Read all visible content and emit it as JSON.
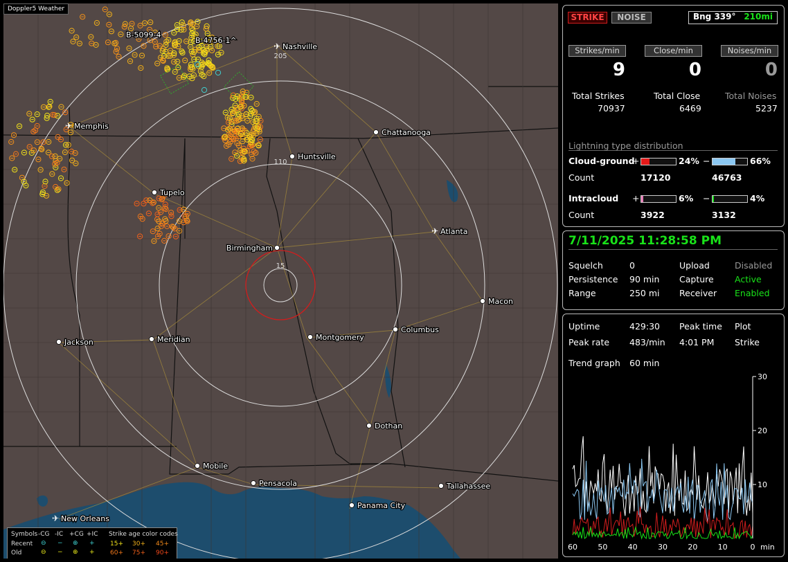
{
  "app_title": "Doppler5 Weather",
  "map": {
    "cities": [
      {
        "name": "Nashville",
        "airport": true
      },
      {
        "name": "Memphis",
        "airport": true
      },
      {
        "name": "Chattanooga",
        "airport": false
      },
      {
        "name": "Huntsville",
        "airport": false
      },
      {
        "name": "Tupelo",
        "airport": false
      },
      {
        "name": "Atlanta",
        "airport": true
      },
      {
        "name": "Birmingham",
        "airport": false
      },
      {
        "name": "Macon",
        "airport": false
      },
      {
        "name": "Jackson",
        "airport": false
      },
      {
        "name": "Meridian",
        "airport": false
      },
      {
        "name": "Montgomery",
        "airport": false
      },
      {
        "name": "Columbus",
        "airport": false
      },
      {
        "name": "Dothan",
        "airport": false
      },
      {
        "name": "Mobile",
        "airport": false
      },
      {
        "name": "Pensacola",
        "airport": false
      },
      {
        "name": "Tallahassee",
        "airport": false
      },
      {
        "name": "Panama City",
        "airport": false
      },
      {
        "name": "New Orleans",
        "airport": true
      }
    ],
    "range_labels": [
      "205",
      "110",
      "15"
    ],
    "cell_labels": [
      "B-5099-4",
      "B-4756-1^"
    ]
  },
  "legend": {
    "symbols_label": "Symbols",
    "col_headers": [
      "-CG",
      "-IC",
      "+CG",
      "+IC"
    ],
    "age_title": "Strike age color codes",
    "rows": [
      {
        "label": "Recent",
        "ages": [
          "15+",
          "30+",
          "45+"
        ]
      },
      {
        "label": "Old",
        "ages": [
          "60+",
          "75+",
          "90+"
        ]
      }
    ]
  },
  "strike_panel": {
    "mode_strike": "STRIKE",
    "mode_noise": "NOISE",
    "bearing": "Bng 339°",
    "distance": "210mi",
    "rate_labels": [
      "Strikes/min",
      "Close/min",
      "Noises/min"
    ],
    "rate_values": [
      "9",
      "0",
      "0"
    ],
    "total_labels": [
      "Total Strikes",
      "Total Close",
      "Total Noises"
    ],
    "total_values": [
      "70937",
      "6469",
      "5237"
    ],
    "distribution_title": "Lightning type distribution",
    "cloud_ground": {
      "label": "Cloud-ground",
      "plus_pct": "24%",
      "minus_pct": "66%",
      "plus_count": "17120",
      "minus_count": "46763",
      "plus_frac": 0.24,
      "minus_frac": 0.66
    },
    "intracloud": {
      "label": "Intracloud",
      "plus_pct": "6%",
      "minus_pct": "4%",
      "plus_count": "3922",
      "minus_count": "3132",
      "plus_frac": 0.06,
      "minus_frac": 0.04
    },
    "count_label": "Count",
    "plus_sign": "+",
    "minus_sign": "−"
  },
  "status_panel": {
    "datetime": "7/11/2025 11:28:58 PM",
    "rows": [
      {
        "k1": "Squelch",
        "v1": "0",
        "k2": "Upload",
        "v2": "Disabled"
      },
      {
        "k1": "Persistence",
        "v1": "90 min",
        "k2": "Capture",
        "v2": "Active"
      },
      {
        "k1": "Range",
        "v1": "250 mi",
        "k2": "Receiver",
        "v2": "Enabled"
      }
    ]
  },
  "trend_panel": {
    "uptime_label": "Uptime",
    "uptime": "429:30",
    "peak_time_label": "Peak time",
    "peak_time": "4:01 PM",
    "plot_label": "Plot",
    "plot_value": "Strike",
    "peak_rate_label": "Peak rate",
    "peak_rate": "483/min",
    "trend_label": "Trend graph",
    "trend_value": "60 min",
    "x_ticks": [
      "60",
      "50",
      "40",
      "30",
      "20",
      "10",
      "0"
    ],
    "x_unit": "min",
    "y_ticks": [
      "30",
      "20",
      "10"
    ]
  },
  "colors": {
    "map_bg": "#534846",
    "water": "#1d4d6d",
    "ring": "#dddddd",
    "close_ring": "#d11d1d",
    "accent_green": "#19e219",
    "strike_red": "#d11d1d"
  }
}
